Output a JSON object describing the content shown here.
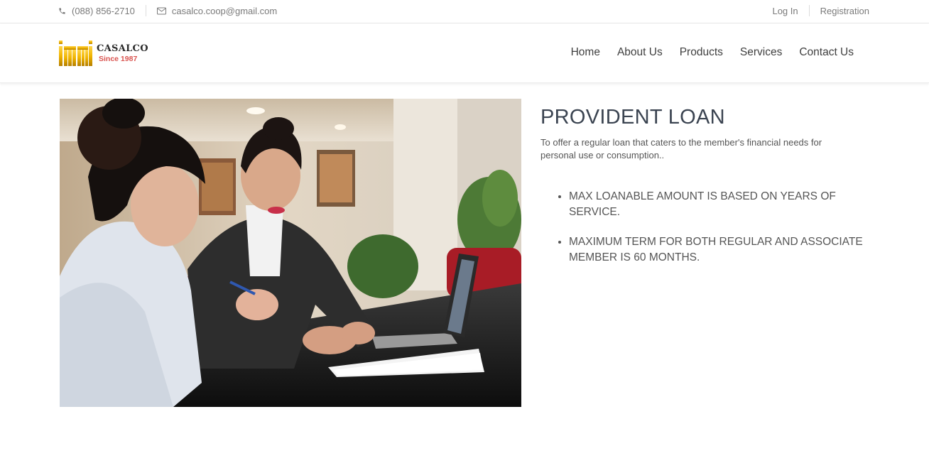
{
  "topbar": {
    "phone": "(088) 856-2710",
    "email": "casalco.coop@gmail.com",
    "login_label": "Log In",
    "register_label": "Registration"
  },
  "brand": {
    "name": "CASALCO",
    "tagline": "Since 1987",
    "logo_color": "#f0b400",
    "tagline_color": "#d9534f"
  },
  "nav": {
    "items": [
      "Home",
      "About Us",
      "Products",
      "Services",
      "Contact Us"
    ]
  },
  "main": {
    "title": "PROVIDENT LOAN",
    "description": "To offer a regular loan that caters to the member's financial needs for personal use or consumption..",
    "features": [
      "MAX LOANABLE AMOUNT IS BASED ON YEARS OF SERVICE.",
      "MAXIMUM TERM FOR BOTH REGULAR AND ASSOCIATE MEMBER IS 60 MONTHS."
    ]
  },
  "icons": {
    "phone": "phone-icon",
    "email": "envelope-icon"
  }
}
